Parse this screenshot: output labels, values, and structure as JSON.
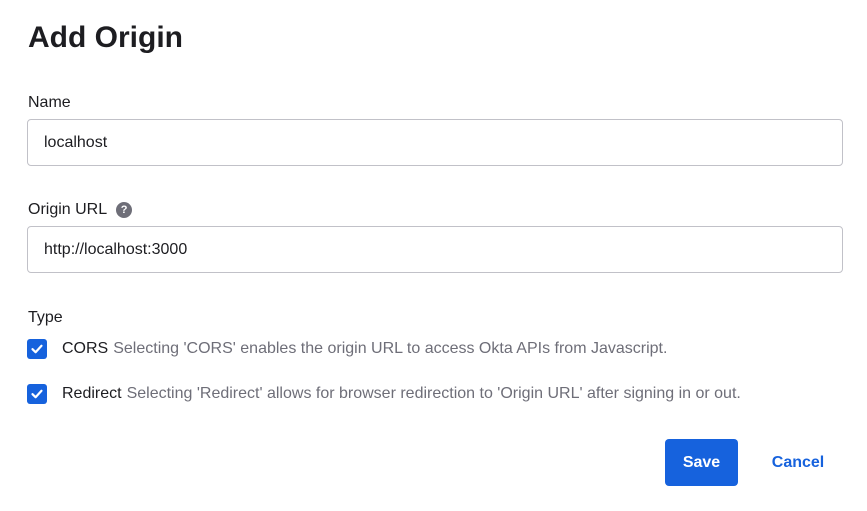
{
  "dialog": {
    "title": "Add Origin"
  },
  "name_field": {
    "label": "Name",
    "value": "localhost"
  },
  "origin_url_field": {
    "label": "Origin URL",
    "help_icon": "question-mark-icon",
    "help_glyph": "?",
    "value": "http://localhost:3000"
  },
  "type_group": {
    "label": "Type",
    "options": [
      {
        "label": "CORS",
        "description": "Selecting 'CORS' enables the origin URL to access Okta APIs from Javascript.",
        "checked": true
      },
      {
        "label": "Redirect",
        "description": "Selecting 'Redirect' allows for browser redirection to 'Origin URL' after signing in or out.",
        "checked": true
      }
    ]
  },
  "actions": {
    "save_label": "Save",
    "cancel_label": "Cancel"
  },
  "colors": {
    "primary": "#1662dd",
    "text": "#1d1d21",
    "muted_text": "#6e6e78",
    "input_border": "#c1c1c8"
  }
}
